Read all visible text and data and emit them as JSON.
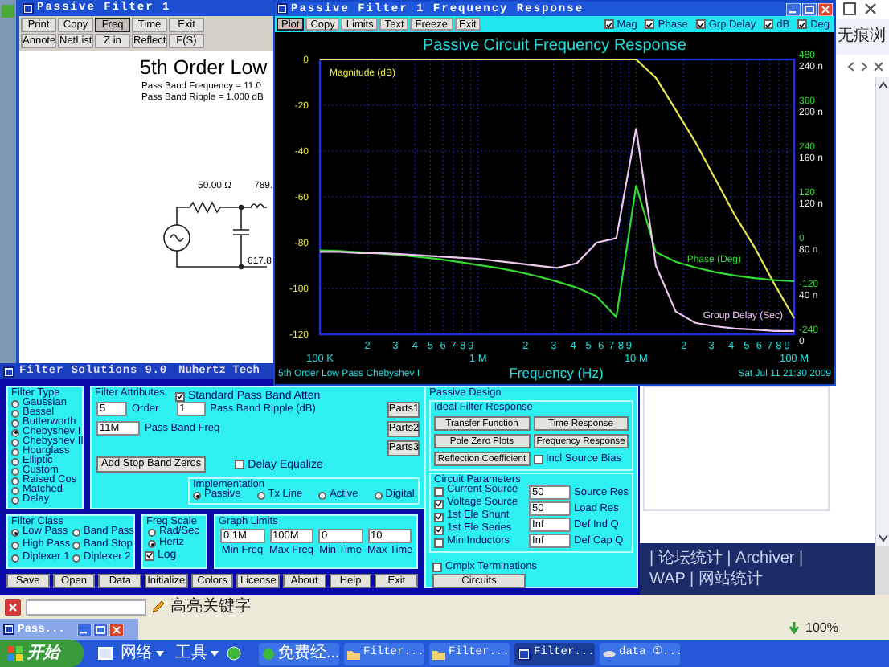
{
  "browser": {
    "tab_text": "无痕浏",
    "footer_links": [
      "| 论坛统计 | Archiver |",
      "WAP | 网站统计"
    ]
  },
  "schematic_window": {
    "title": "Passive Filter 1",
    "toolbar": [
      [
        {
          "label": "Print",
          "selected": false
        },
        {
          "label": "Copy",
          "selected": false
        },
        {
          "label": "Freq",
          "selected": true
        },
        {
          "label": "Time",
          "selected": false
        },
        {
          "label": "Exit",
          "selected": false
        }
      ],
      [
        {
          "label": "Annote",
          "selected": false
        },
        {
          "label": "NetList",
          "selected": false
        },
        {
          "label": "Z in",
          "selected": false
        },
        {
          "label": "Reflect",
          "selected": false
        },
        {
          "label": "F(S)",
          "selected": false
        }
      ]
    ],
    "heading": "5th Order Low",
    "info": [
      "Pass Band Frequency = 11.0",
      "Pass Band Ripple = 1.000 dB"
    ],
    "component_labels": [
      "50.00 Ω",
      "789.",
      "617.8"
    ]
  },
  "response_window": {
    "title": "Passive Filter 1 Frequency Response",
    "toolbar": [
      {
        "label": "Plot",
        "selected": true
      },
      {
        "label": "Copy",
        "selected": false
      },
      {
        "label": "Limits",
        "selected": false
      },
      {
        "label": "Text",
        "selected": false
      },
      {
        "label": "Freeze",
        "selected": false
      },
      {
        "label": "Exit",
        "selected": false
      }
    ],
    "toggles": [
      {
        "label": "Mag",
        "checked": true
      },
      {
        "label": "Phase",
        "checked": true
      },
      {
        "label": "Grp Delay",
        "checked": true
      },
      {
        "label": "dB",
        "checked": true
      },
      {
        "label": "Deg",
        "checked": true
      }
    ],
    "chart": {
      "magnitude_chart": {
        "chart_data": {
          "type": "line",
          "title": "Passive Circuit Frequency Response",
          "xlabel": "Frequency (Hz)",
          "categories": [
            "100 K",
            null,
            null,
            null,
            null,
            null,
            null,
            null,
            "1 M",
            null,
            null,
            null,
            null,
            null,
            null,
            null,
            "10 M",
            null,
            null,
            null,
            null,
            null,
            null,
            null,
            "100 M"
          ],
          "series": [
            {
              "name": "Magnitude (dB)",
              "color": "#e8e84a",
              "values": [
                0,
                0,
                0,
                0,
                0,
                0,
                0,
                0,
                0,
                0,
                0,
                0,
                0,
                0,
                0,
                0,
                0,
                -8,
                -22,
                -36,
                -52,
                -68,
                -82,
                -98,
                -113
              ]
            }
          ],
          "ylim": [
            -120,
            0
          ],
          "grid": true,
          "yticks": [
            0,
            -20,
            -40,
            -60,
            -80,
            -100,
            -120
          ]
        }
      },
      "phase_chart": {
        "chart_data": {
          "type": "line",
          "categories": [
            null,
            null,
            null,
            null,
            null,
            null,
            null,
            null,
            null,
            null,
            null,
            null,
            null,
            null,
            null,
            null,
            null,
            null,
            null,
            null,
            null,
            null,
            null,
            null,
            null
          ],
          "series": [
            {
              "name": "Phase (Deg)",
              "color": "#33dd33",
              "values": [
                -20,
                -22,
                -25,
                -28,
                -32,
                -37,
                -43,
                -50,
                -58,
                -66,
                -76,
                -88,
                -102,
                -118,
                -140,
                -195,
                150,
                -25,
                -50,
                -65,
                -77,
                -86,
                -93,
                -98,
                -101
              ]
            }
          ],
          "ylim": [
            -240,
            480
          ],
          "yticks": [
            480,
            360,
            240,
            120,
            0,
            -120,
            -240
          ]
        }
      },
      "delay_chart": {
        "chart_data": {
          "type": "line",
          "categories": [
            null,
            null,
            null,
            null,
            null,
            null,
            null,
            null,
            null,
            null,
            null,
            null,
            null,
            null,
            null,
            null,
            null,
            null,
            null,
            null,
            null,
            null,
            null,
            null,
            null
          ],
          "series": [
            {
              "name": "Group Delay (Sec)",
              "color": "#eec8ee",
              "values": [
                72,
                72,
                71,
                71,
                70,
                69,
                68,
                67,
                66,
                64,
                62,
                60,
                58,
                62,
                80,
                84,
                180,
                60,
                20,
                10,
                7,
                5,
                4,
                3,
                3
              ]
            }
          ],
          "ylim": [
            0,
            240
          ],
          "yticks": [
            {
              "value": 240,
              "label": "240 n"
            },
            {
              "value": 200,
              "label": "200 n"
            },
            {
              "value": 160,
              "label": "160 n"
            },
            {
              "value": 120,
              "label": "120 n"
            },
            {
              "value": 80,
              "label": "80 n"
            },
            {
              "value": 40,
              "label": "40 n"
            },
            {
              "value": 0,
              "label": "0"
            }
          ]
        }
      },
      "minor_tick_labels": [
        "2",
        "3",
        "4",
        "5",
        "6",
        "7",
        "8",
        "9",
        "2",
        "3",
        "4",
        "5",
        "6",
        "7",
        "8",
        "9",
        "2",
        "3",
        "4",
        "5",
        "6",
        "7",
        "8",
        "9"
      ],
      "footer_left": "5th Order Low Pass Chebyshev I",
      "footer_right": "Sat Jul 11 21:30 2009"
    }
  },
  "solutions_window": {
    "title": "Filter Solutions 9.0",
    "vendor": "Nuhertz Tech",
    "filter_type": {
      "label": "Filter Type",
      "options": [
        {
          "label": "Gaussian",
          "selected": false
        },
        {
          "label": "Bessel",
          "selected": false
        },
        {
          "label": "Butterworth",
          "selected": false
        },
        {
          "label": "Chebyshev I",
          "selected": true
        },
        {
          "label": "Chebyshev II",
          "selected": false
        },
        {
          "label": "Hourglass",
          "selected": false
        },
        {
          "label": "Elliptic",
          "selected": false
        },
        {
          "label": "Custom",
          "selected": false
        },
        {
          "label": "Raised Cos",
          "selected": false
        },
        {
          "label": "Matched",
          "selected": false
        },
        {
          "label": "Delay",
          "selected": false
        }
      ]
    },
    "filter_attributes": {
      "label": "Filter Attributes",
      "standard_atten": {
        "label": "Standard Pass Band Atten",
        "checked": true
      },
      "order": {
        "value": "5",
        "label": "Order"
      },
      "ripple": {
        "value": "1",
        "label": "Pass Band Ripple (dB)"
      },
      "pass_band_freq": {
        "value": "11M",
        "label": "Pass Band Freq"
      },
      "parts_buttons": [
        "Parts1",
        "Parts2",
        "Parts3"
      ],
      "add_zeros_button": "Add Stop Band Zeros",
      "delay_equalize": {
        "label": "Delay Equalize",
        "checked": false
      },
      "implementation": {
        "label": "Implementation",
        "options": [
          {
            "label": "Passive",
            "selected": true
          },
          {
            "label": "Tx Line",
            "selected": false
          },
          {
            "label": "Active",
            "selected": false
          },
          {
            "label": "Digital",
            "selected": false
          }
        ]
      }
    },
    "filter_class": {
      "label": "Filter Class",
      "options": [
        {
          "label": "Low Pass",
          "selected": true
        },
        {
          "label": "Band Pass",
          "selected": false
        },
        {
          "label": "High Pass",
          "selected": false
        },
        {
          "label": "Band Stop",
          "selected": false
        },
        {
          "label": "Diplexer 1",
          "selected": false
        },
        {
          "label": "Diplexer 2",
          "selected": false
        }
      ]
    },
    "freq_scale": {
      "label": "Freq Scale",
      "options": [
        {
          "label": "Rad/Sec",
          "selected": false
        },
        {
          "label": "Hertz",
          "selected": true
        }
      ],
      "log": {
        "label": "Log",
        "checked": true
      }
    },
    "graph_limits": {
      "label": "Graph Limits",
      "fields": [
        {
          "value": "0.1M",
          "label": "Min Freq"
        },
        {
          "value": "100M",
          "label": "Max Freq"
        },
        {
          "value": "0",
          "label": "Min Time"
        },
        {
          "value": "10",
          "label": "Max Time"
        }
      ]
    },
    "buttons": [
      "Save",
      "Open",
      "Data",
      "Initialize",
      "Colors",
      "License",
      "About",
      "Help",
      "Exit"
    ],
    "passive_design": {
      "label": "Passive Design",
      "ideal": {
        "label": "Ideal Filter Response",
        "buttons": [
          "Transfer Function",
          "Time Response",
          "Pole Zero Plots",
          "Frequency Response",
          "Reflection Coefficient"
        ],
        "incl_source_bias": {
          "label": "Incl Source Bias",
          "checked": false
        }
      },
      "circuit": {
        "label": "Circuit Parameters",
        "options": [
          {
            "label": "Current Source",
            "checked": false
          },
          {
            "label": "Voltage Source",
            "checked": true
          },
          {
            "label": "1st Ele Shunt",
            "checked": true
          },
          {
            "label": "1st Ele Series",
            "checked": true
          },
          {
            "label": "Min Inductors",
            "checked": false
          }
        ],
        "fields": [
          {
            "value": "50",
            "label": "Source Res"
          },
          {
            "value": "50",
            "label": "Load Res"
          },
          {
            "value": "Inf",
            "label": "Def Ind Q"
          },
          {
            "value": "Inf",
            "label": "Def Cap Q"
          }
        ],
        "cmplx": {
          "label": "Cmplx Terminations",
          "checked": false
        },
        "circuits_button": "Circuits"
      }
    }
  },
  "search_bar": {
    "label": "高亮关键字"
  },
  "zoom_level": "100%",
  "minimized_window": {
    "title": "Pass..."
  },
  "taskbar": {
    "start": "开始",
    "menus": [
      "网络",
      "工具"
    ],
    "tasks": [
      {
        "label": "免费经...",
        "kind": "web",
        "selected": false
      },
      {
        "label": "Filter...",
        "kind": "folder",
        "selected": false
      },
      {
        "label": "Filter...",
        "kind": "folder",
        "selected": false
      },
      {
        "label": "Filter...",
        "kind": "app",
        "selected": true
      },
      {
        "label": "data ①...",
        "kind": "file",
        "selected": false
      }
    ]
  }
}
